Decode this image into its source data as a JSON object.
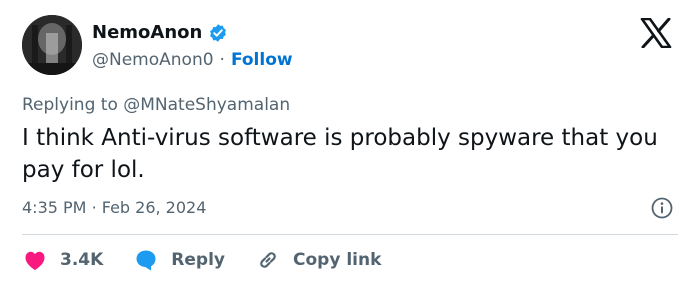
{
  "user": {
    "name": "NemoAnon",
    "handle": "@NemoAnon0",
    "follow_label": "Follow",
    "verified": true
  },
  "reply": {
    "prefix": "Replying to",
    "mention": "@MNateShyamalan"
  },
  "tweet": {
    "text": "I think Anti-virus software is probably spyware that you pay for lol."
  },
  "meta": {
    "time": "4:35 PM",
    "date": "Feb 26, 2024"
  },
  "actions": {
    "likes": "3.4K",
    "reply_label": "Reply",
    "copy_label": "Copy link"
  },
  "colors": {
    "accent": "#0074d4",
    "like": "#f91880",
    "reply": "#1d9bf0",
    "muted": "#536471"
  },
  "icons": [
    "verified-badge-icon",
    "x-logo-icon",
    "info-icon",
    "heart-icon",
    "reply-bubble-icon",
    "link-icon"
  ]
}
